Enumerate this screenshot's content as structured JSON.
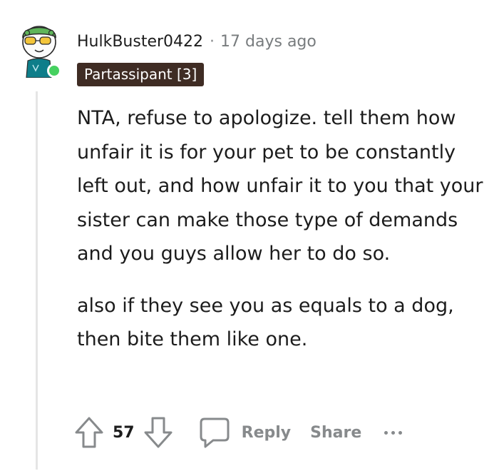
{
  "comment": {
    "author": "HulkBuster0422",
    "separator": "·",
    "time_ago": "17 days ago",
    "flair": "Partassipant [3]",
    "paragraphs": [
      "NTA, refuse to apologize. tell them how unfair it is for your pet to be constantly left out, and how unfair it to you that your sister can make those type of demands and you guys allow her to do so.",
      "also if they see you as equals to a dog, then bite them like one."
    ]
  },
  "actions": {
    "score": "57",
    "reply_label": "Reply",
    "share_label": "Share"
  },
  "icons": {
    "upvote": "arrow-up-outline-icon",
    "downvote": "arrow-down-outline-icon",
    "reply": "speech-bubble-icon",
    "more": "ellipsis-horizontal-icon",
    "online": "online-status-dot"
  },
  "colors": {
    "flair_background": "#3f2c24",
    "online_dot": "#46d160",
    "muted_text": "#878a8c",
    "avatar_green": "#5fb55a"
  }
}
